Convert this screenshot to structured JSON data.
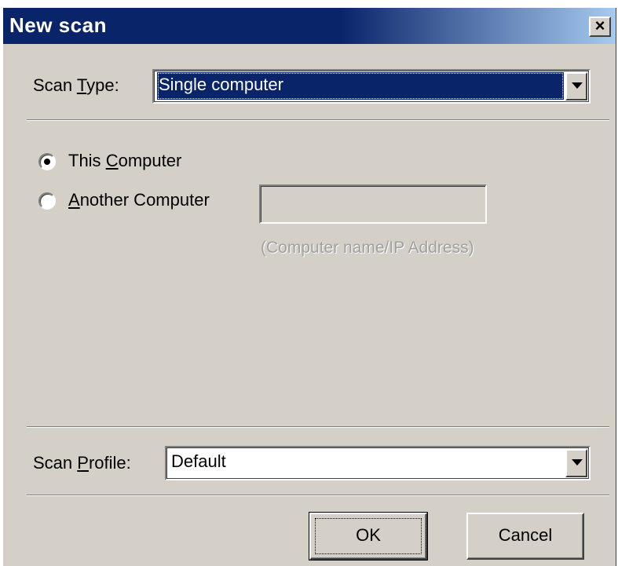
{
  "window": {
    "title": "New scan",
    "close_label": "×"
  },
  "scan_type": {
    "label_pre": "Scan ",
    "label_accel": "T",
    "label_post": "ype:",
    "value": "Single computer"
  },
  "target": {
    "this_computer": {
      "label_pre": "This ",
      "label_accel": "C",
      "label_post": "omputer",
      "checked": true
    },
    "another_computer": {
      "label_pre": "",
      "label_accel": "A",
      "label_post": "nother Computer",
      "checked": false,
      "input_value": "",
      "hint": "(Computer name/IP Address)"
    }
  },
  "scan_profile": {
    "label_pre": "Scan ",
    "label_accel": "P",
    "label_post": "rofile:",
    "value": "Default"
  },
  "buttons": {
    "ok": "OK",
    "cancel": "Cancel"
  }
}
